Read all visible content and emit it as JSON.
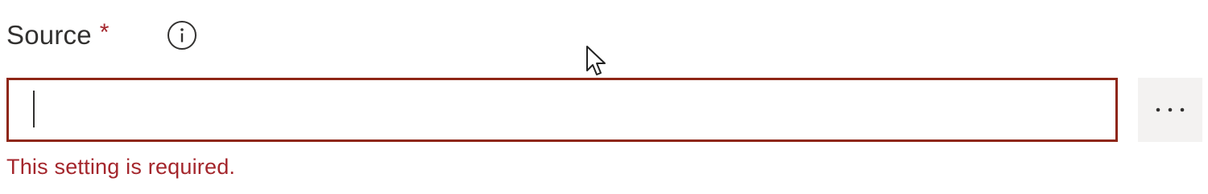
{
  "field": {
    "label": "Source",
    "required_marker": "*",
    "value": "",
    "placeholder": "",
    "error_message": "This setting is required."
  },
  "icons": {
    "info": "info-icon",
    "more": "ellipsis-icon",
    "cursor": "mouse-pointer-icon"
  },
  "colors": {
    "label": "#323130",
    "error": "#a4262c",
    "error_border": "#8e2616",
    "button_bg": "#f3f2f1"
  }
}
